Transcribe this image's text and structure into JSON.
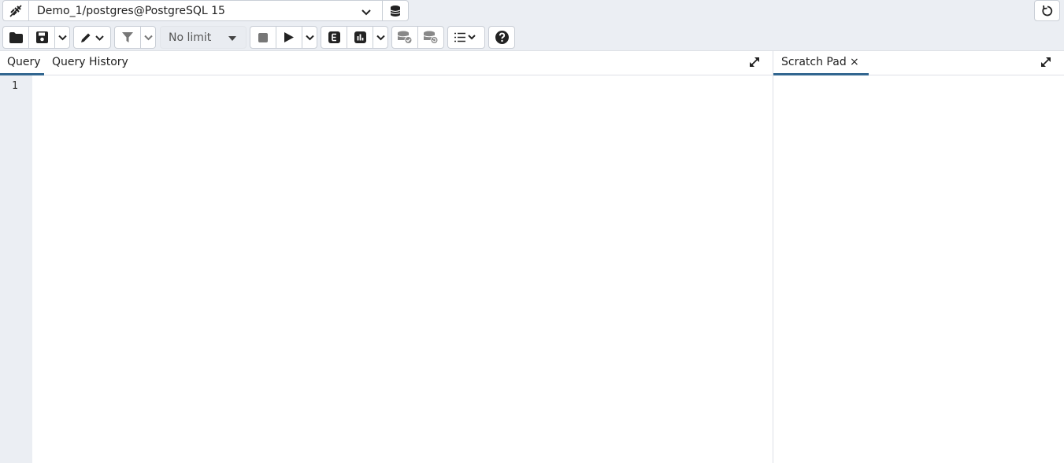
{
  "connection": {
    "label": "Demo_1/postgres@PostgreSQL 15"
  },
  "toolbar": {
    "row_limit": "No limit"
  },
  "query_panel": {
    "tabs": [
      {
        "label": "Query",
        "active": true
      },
      {
        "label": "Query History",
        "active": false
      }
    ],
    "line_numbers": [
      "1"
    ]
  },
  "scratch_panel": {
    "tab_label": "Scratch Pad",
    "close_glyph": "×"
  },
  "icons": {
    "connection_status": "connection-status-icon",
    "database": "database-icon",
    "reset_layout": "reset-layout-icon",
    "open_file": "folder-icon",
    "save_file": "save-icon",
    "edit": "pencil-icon",
    "filter": "filter-icon",
    "stop": "stop-icon",
    "execute": "play-icon",
    "explain": "explain-icon",
    "explain_analyze": "bar-chart-icon",
    "commit": "commit-icon",
    "rollback": "rollback-icon",
    "macros": "list-icon",
    "help": "help-icon",
    "expand": "expand-icon"
  },
  "colors": {
    "accent": "#326690",
    "toolbar_bg": "#ebeef3",
    "border": "#c9ced6"
  }
}
